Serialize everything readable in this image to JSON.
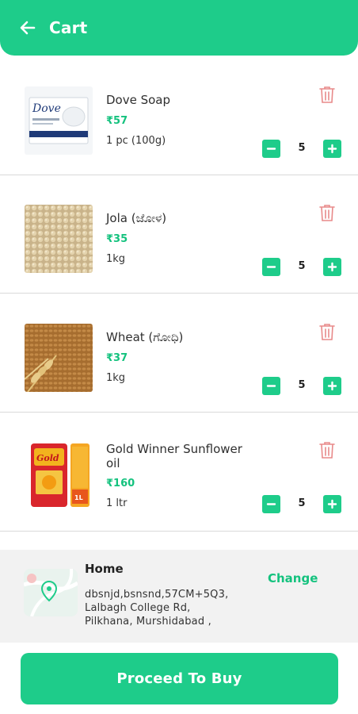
{
  "header": {
    "title": "Cart"
  },
  "items": [
    {
      "name": "Dove Soap",
      "price": "₹57",
      "unit": "1 pc (100g)",
      "quantity": "5",
      "thumb_label": "Dove"
    },
    {
      "name": "Jola (ಜೋಳ)",
      "price": "₹35",
      "unit": "1kg",
      "quantity": "5"
    },
    {
      "name": "Wheat (ಗೋಧಿ)",
      "price": "₹37",
      "unit": "1kg",
      "quantity": "5"
    },
    {
      "name": "Gold Winner Sunflower oil",
      "price": "₹160",
      "unit": "1 ltr",
      "quantity": "5",
      "thumb_label": "Gold",
      "thumb_badge": "1L"
    }
  ],
  "address": {
    "label": "Home",
    "line1": "dbsnjd,bsnsnd,57CM+5Q3,",
    "line2": "Lalbagh College Rd,",
    "line3": "Pilkhana,  Murshidabad ,",
    "change_label": "Change"
  },
  "cta": {
    "label": "Proceed To Buy"
  },
  "colors": {
    "accent": "#1ecc8a",
    "price": "#14c27e",
    "delete": "#e88a8a"
  },
  "icons": [
    "back-arrow-icon",
    "trash-icon",
    "minus-icon",
    "plus-icon",
    "location-pin-icon"
  ]
}
